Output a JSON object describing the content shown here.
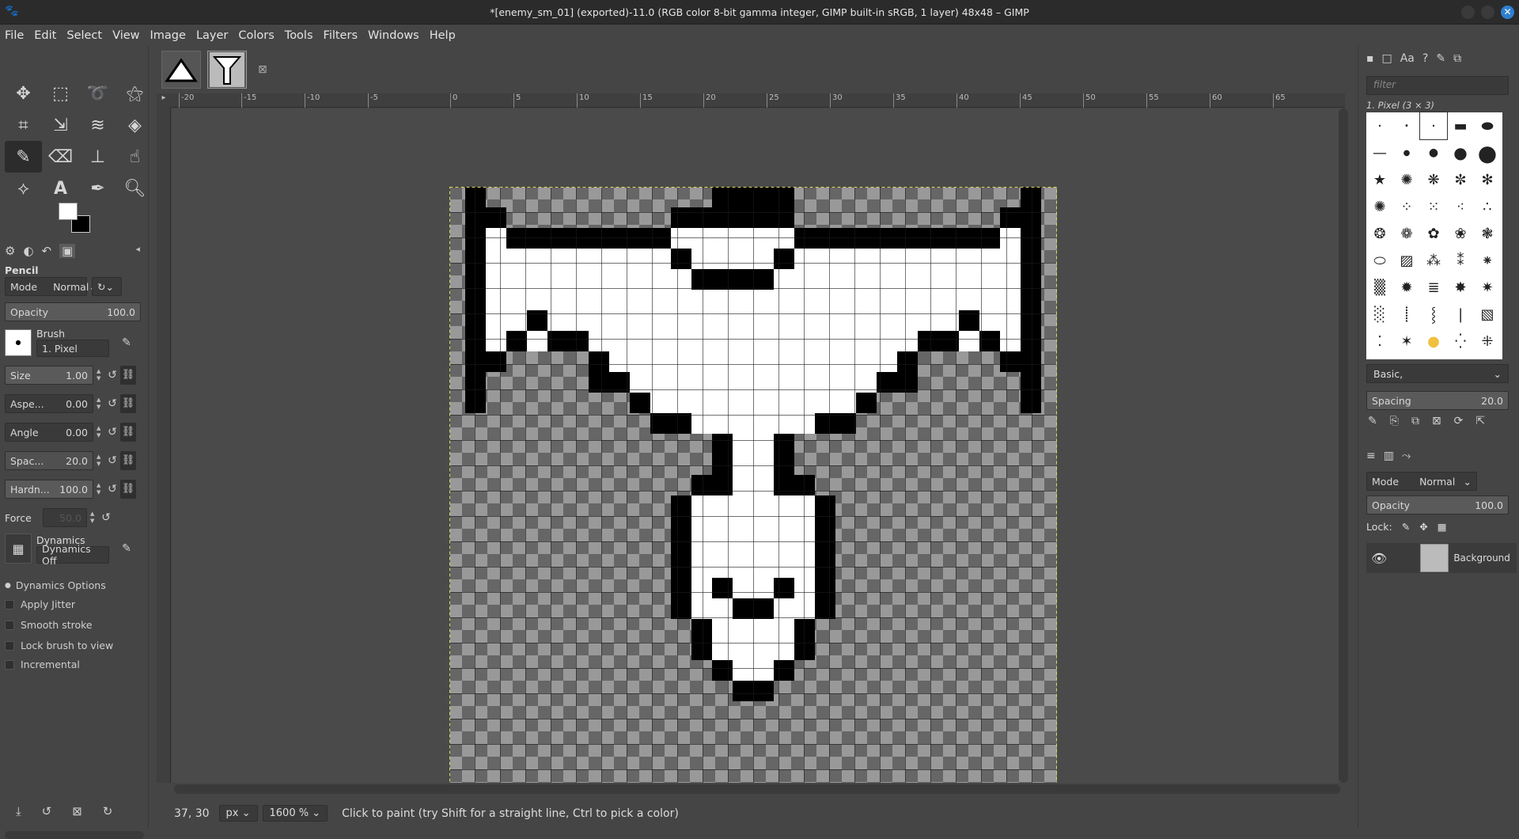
{
  "window": {
    "title": "*[enemy_sm_01] (exported)-11.0 (RGB color 8-bit gamma integer, GIMP built-in sRGB, 1 layer) 48x48 – GIMP"
  },
  "menu": [
    "File",
    "Edit",
    "Select",
    "View",
    "Image",
    "Layer",
    "Colors",
    "Tools",
    "Filters",
    "Windows",
    "Help"
  ],
  "tools": [
    "move-icon",
    "rect-select-icon",
    "lasso-icon",
    "fuzzy-select-icon",
    "crop-icon",
    "transform-icon",
    "warp-icon",
    "bucket-icon",
    "pencil-icon",
    "eraser-icon",
    "clone-icon",
    "smudge-icon",
    "path-icon",
    "text-icon",
    "color-picker-icon",
    "zoom-icon"
  ],
  "tool_options": {
    "tool_name": "Pencil",
    "mode_label": "Mode",
    "mode_value": "Normal",
    "opacity_label": "Opacity",
    "opacity_value": "100.0",
    "brush_label": "Brush",
    "brush_value": "1. Pixel",
    "size_label": "Size",
    "size_value": "1.00",
    "aspect_label": "Aspe...",
    "aspect_value": "0.00",
    "angle_label": "Angle",
    "angle_value": "0.00",
    "spacing_label": "Spac...",
    "spacing_value": "20.0",
    "hardness_label": "Hardn...",
    "hardness_value": "100.0",
    "force_label": "Force",
    "force_value": "50.0",
    "dynamics_label": "Dynamics",
    "dynamics_value": "Dynamics Off",
    "dyn_options": "Dynamics Options",
    "apply_jitter": "Apply Jitter",
    "smooth_stroke": "Smooth stroke",
    "lock_brush": "Lock brush to view",
    "incremental": "Incremental"
  },
  "ruler": {
    "labels": [
      "-20",
      "-15",
      "-10",
      "-5",
      "0",
      "5",
      "10",
      "15",
      "20",
      "25",
      "30",
      "35",
      "40",
      "45",
      "50",
      "55",
      "60",
      "65"
    ]
  },
  "canvas": {
    "pixels": [
      "1000000000001111000000000001",
      "1100000000111111000000000011",
      "1211111111222222111111111121",
      "1222222222122221222222222221",
      "1222222222211112222222222221",
      "1222222222222222222222222221",
      "1221222222222222222222221221",
      "1212112222222222222222112121",
      "1100001222222222222221000011",
      "1000001122222222222211000001",
      "1000000012222222222100000001",
      "0000000001122222211000000000",
      "0000000000001221000000000000",
      "0000000000001221000000000000",
      "0000000000011221100000000000",
      "0000000000122222210000000000",
      "0000000000122222210000000000",
      "0000000000122222210000000000",
      "0000000000122222210000000000",
      "0000000000121221210000000000",
      "0000000000122112210000000000",
      "0000000000012222100000000000",
      "0000000000012222100000000000",
      "0000000000001221000000000000",
      "0000000000000110000000000000"
    ]
  },
  "status": {
    "coords": "37, 30",
    "unit": "px",
    "zoom": "1600 %",
    "message": "Click to paint (try Shift for a straight line, Ctrl to pick a color)"
  },
  "right": {
    "filter_placeholder": "filter",
    "brush_name": "1. Pixel (3 × 3)",
    "brush_set": "Basic,",
    "spacing_label": "Spacing",
    "spacing_value": "20.0",
    "layers_mode_label": "Mode",
    "layers_mode_value": "Normal",
    "layers_opacity_label": "Opacity",
    "layers_opacity_value": "100.0",
    "lock_label": "Lock:",
    "layer_name": "Background"
  }
}
